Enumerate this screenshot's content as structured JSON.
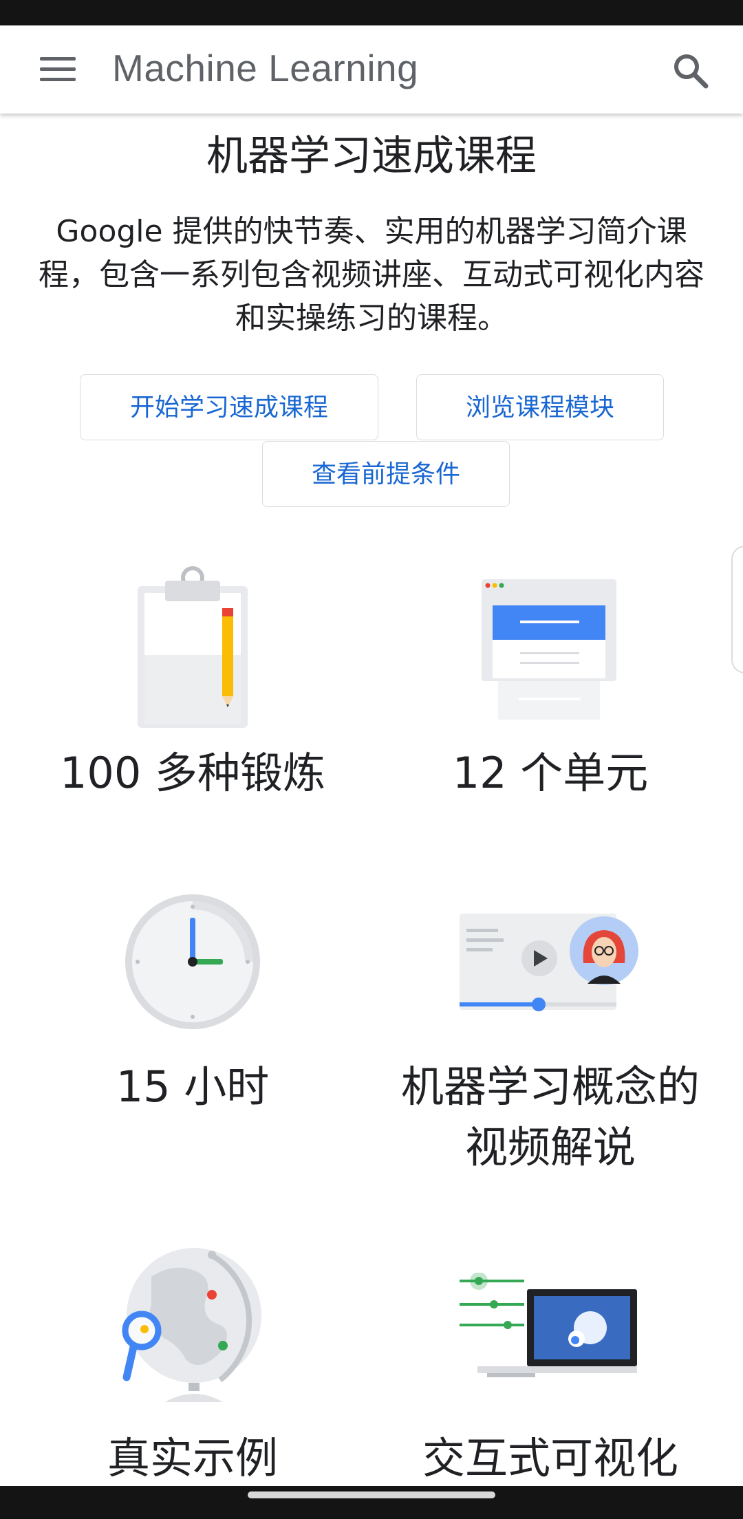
{
  "app_bar": {
    "title": "Machine Learning",
    "menu_icon": "menu-icon",
    "search_icon": "search-icon"
  },
  "hero": {
    "title": "机器学习速成课程",
    "description": "Google 提供的快节奏、实用的机器学习简介课程，包含一系列包含视频讲座、互动式可视化内容和实操练习的课程。"
  },
  "buttons": {
    "start": "开始学习速成课程",
    "browse": "浏览课程模块",
    "prereq": "查看前提条件"
  },
  "features": [
    {
      "label": "100 多种锻炼",
      "icon": "clipboard-pencil-icon"
    },
    {
      "label": "12 个单元",
      "icon": "browser-window-icon"
    },
    {
      "label": "15 小时",
      "icon": "clock-icon"
    },
    {
      "label": "机器学习概念的视频解说",
      "icon": "video-player-icon"
    },
    {
      "label": "真实示例",
      "icon": "globe-magnifier-icon"
    },
    {
      "label": "交互式可视化",
      "icon": "sliders-monitor-icon"
    }
  ],
  "colors": {
    "accent_text": "#1967d2",
    "blue": "#4285f4",
    "green": "#34a853",
    "red": "#ea4335",
    "yellow": "#fbbc04"
  }
}
